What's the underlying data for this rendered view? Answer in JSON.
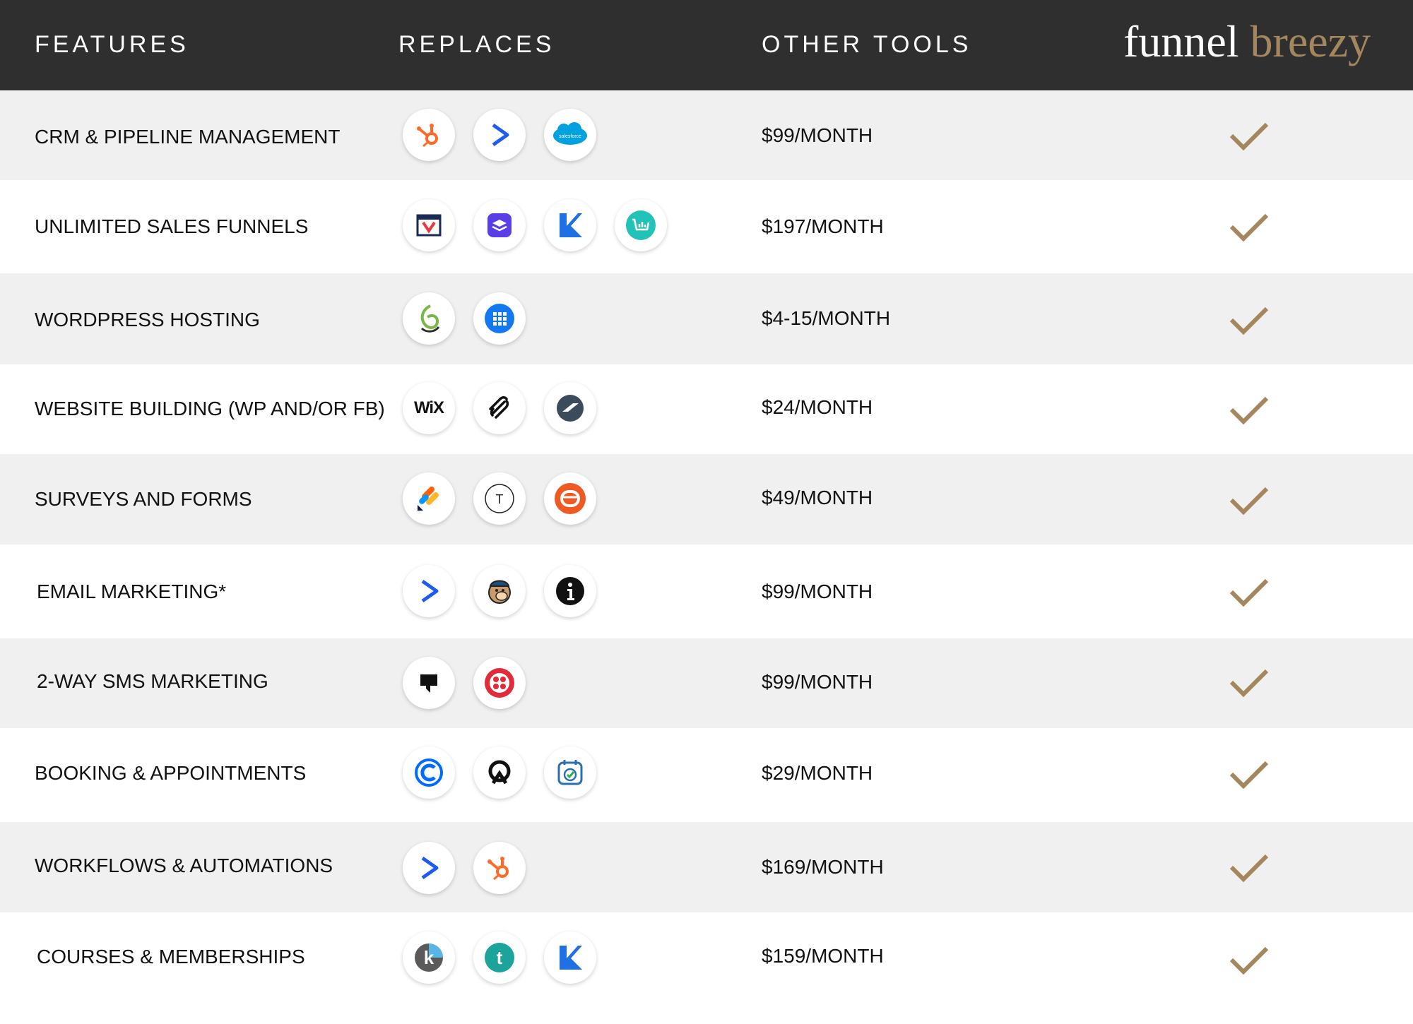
{
  "header": {
    "features": "FEATURES",
    "replaces": "REPLACES",
    "other_tools": "OTHER TOOLS",
    "brand_part1": "funnel",
    "brand_part2": "breezy"
  },
  "colors": {
    "header_bg": "#2f2f2f",
    "brand_accent": "#a4875d",
    "row_shade": "#f0f0f0",
    "check": "#a4875d"
  },
  "rows": [
    {
      "feature": "CRM & PIPELINE MANAGEMENT",
      "price": "$99/MONTH",
      "icons": [
        "hubspot-icon",
        "activecampaign-icon",
        "salesforce-icon"
      ],
      "salesforce_label": "salesforce"
    },
    {
      "feature": "UNLIMITED SALES FUNNELS",
      "price": "$197/MONTH",
      "icons": [
        "clickfunnels-icon",
        "leadpages-icon",
        "kartra-icon",
        "samcart-icon"
      ]
    },
    {
      "feature": "WORDPRESS HOSTING",
      "price": "$4-15/MONTH",
      "icons": [
        "siteground-icon",
        "bluehost-icon"
      ]
    },
    {
      "feature": "WEBSITE BUILDING (WP AND/OR FB)",
      "price": "$24/MONTH",
      "icons": [
        "wix-icon",
        "squarespace-icon",
        "elementor-icon"
      ],
      "wix_label": "WiX"
    },
    {
      "feature": "SURVEYS AND FORMS",
      "price": "$49/MONTH",
      "icons": [
        "jotform-icon",
        "typeform-icon",
        "surveymonkey-icon"
      ],
      "typeform_label": "T"
    },
    {
      "feature": "EMAIL MARKETING*",
      "price": "$99/MONTH",
      "icons": [
        "activecampaign-icon",
        "mailchimp-icon",
        "infusionsoft-icon"
      ]
    },
    {
      "feature": "2-WAY SMS MARKETING",
      "price": "$99/MONTH",
      "icons": [
        "podium-icon",
        "twilio-icon"
      ]
    },
    {
      "feature": "BOOKING & APPOINTMENTS",
      "price": "$29/MONTH",
      "icons": [
        "calendly-icon",
        "acuity-icon",
        "calendar-check-icon"
      ]
    },
    {
      "feature": "WORKFLOWS & AUTOMATIONS",
      "price": "$169/MONTH",
      "icons": [
        "activecampaign-icon",
        "hubspot-icon"
      ]
    },
    {
      "feature": "COURSES & MEMBERSHIPS",
      "price": "$159/MONTH",
      "icons": [
        "kajabi-icon",
        "teachable-icon",
        "kartra-icon"
      ],
      "kajabi_label": "k",
      "teachable_label": "t"
    }
  ]
}
